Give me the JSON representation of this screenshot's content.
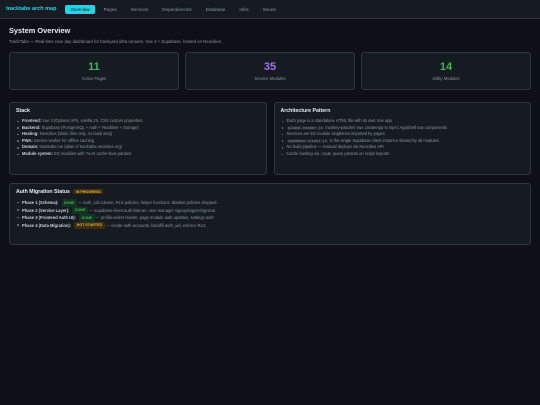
{
  "brand": "tracktabs arch map",
  "nav": [
    {
      "label": "Overview",
      "active": true
    },
    {
      "label": "Pages",
      "active": false
    },
    {
      "label": "Services",
      "active": false
    },
    {
      "label": "Dependencies",
      "active": false
    },
    {
      "label": "Database",
      "active": false
    },
    {
      "label": "Infra",
      "active": false
    },
    {
      "label": "Issues",
      "active": false
    }
  ],
  "page": {
    "title": "System Overview",
    "subtitle": "TrackTabs — Real-time race day dashboard for backyard ultra runners. Vue 3 + Supabase, hosted on Neocities."
  },
  "stats": [
    {
      "value": "11",
      "label": "Active Pages",
      "color": "#3fb950"
    },
    {
      "value": "35",
      "label": "Service Modules",
      "color": "#a371f7"
    },
    {
      "value": "14",
      "label": "Utility Modules",
      "color": "#3fb950"
    }
  ],
  "stack": {
    "title": "Stack",
    "items": [
      {
        "key": "Frontend:",
        "text": " Vue 3 (Options API), vanilla JS, CSS custom properties"
      },
      {
        "key": "Backend:",
        "text": " Supabase (PostgreSQL + Auth + Realtime + Storage)"
      },
      {
        "key": "Hosting:",
        "text": " Neocities (static files only, no build step)"
      },
      {
        "key": "PWA:",
        "text": " Service worker for offline caching"
      },
      {
        "key": "Domain:",
        "text": " tracktabs.run (alias of tracktabs.neocities.org)"
      },
      {
        "key": "Module system:",
        "text": " ES modules with ?v=N cache-bust params"
      }
    ]
  },
  "architecture": {
    "title": "Architecture Pattern",
    "items": [
      {
        "pre": "Each page is a standalone HTML file with its own Vue app",
        "code": "",
        "post": ""
      },
      {
        "pre": "",
        "code": "global-header.js",
        "post": " monkey-patches Vue.createApp to inject AppShell nav components"
      },
      {
        "pre": "Services are ES module singletons imported by pages",
        "code": "",
        "post": ""
      },
      {
        "pre": "",
        "code": "supabase-client.js",
        "post": " is the single Supabase client instance shared by all modules"
      },
      {
        "pre": "No build pipeline — manual deploys via Neocities API",
        "code": "",
        "post": ""
      },
      {
        "pre": "Cache busting via ",
        "code": "?v=N",
        "post": " query params on script imports"
      }
    ]
  },
  "auth": {
    "title": "Auth Migration Status",
    "status_badge": "IN PROGRESS",
    "phases": [
      {
        "key": "Phase 1 (Schema):",
        "badge": "DONE",
        "badge_type": "done",
        "text": " — auth_uid column, RLS policies, helper functions. Blanket policies dropped."
      },
      {
        "key": "Phase 2 (Service Layer):",
        "badge": "DONE",
        "badge_type": "done",
        "text": " — supabase-client auth listener, user-manager signUp/signIn/signOut"
      },
      {
        "key": "Phase 3 (Frontend Auth UI):",
        "badge": "DONE",
        "badge_type": "done",
        "text": " — profile-select rewrite, page module auth updates, settings auth"
      },
      {
        "key": "Phase 4 (Data Migration):",
        "badge": "NOT STARTED",
        "badge_type": "notstarted",
        "text": " — create auth accounts, backfill auth_uid, enforce RLS"
      }
    ]
  }
}
